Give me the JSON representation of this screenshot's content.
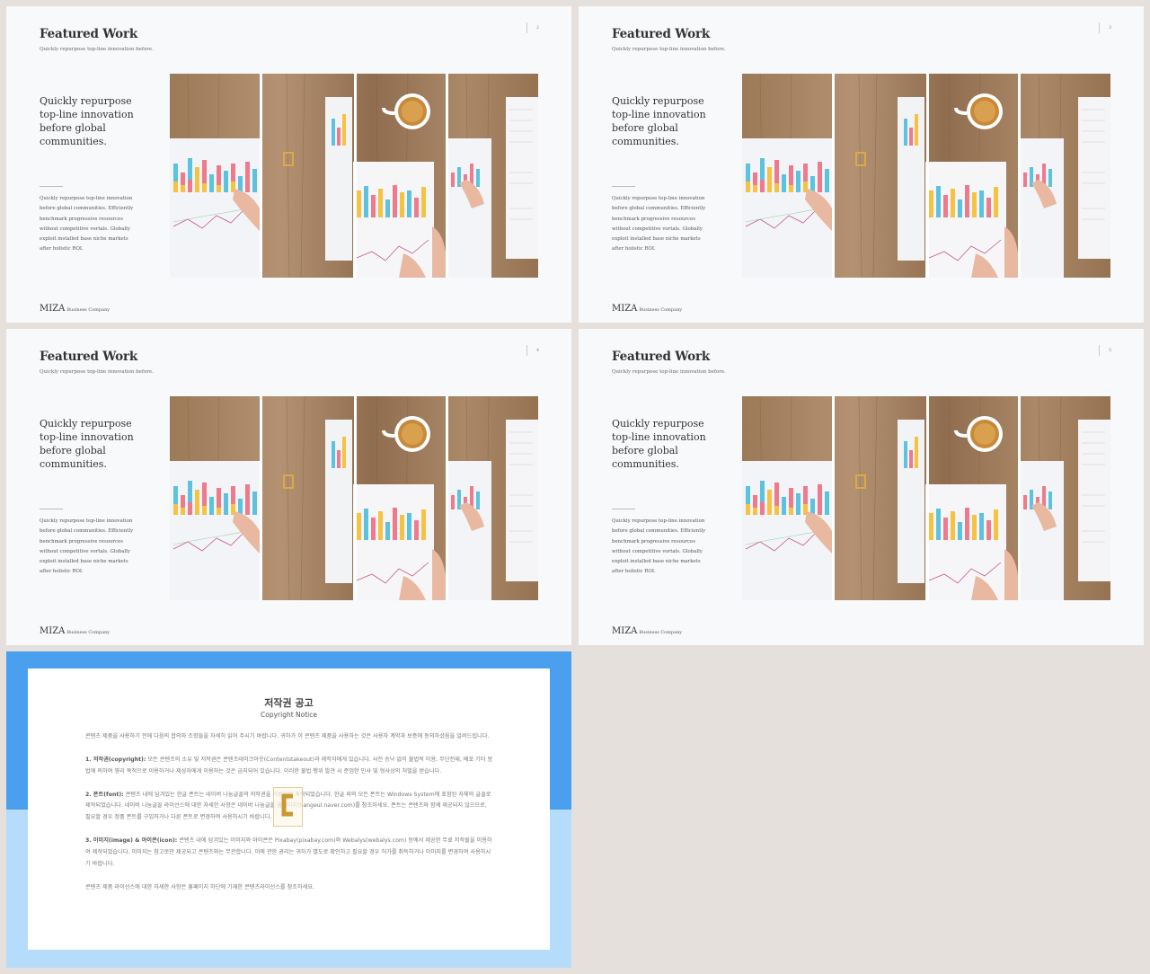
{
  "slides": [
    {
      "title": "Featured Work",
      "subtitle": "Quickly repurpose top-line innovation before.",
      "page_number": "2",
      "headline": "Quickly repurpose top-line innovation before global communities.",
      "body": "Quickly repurpose top-line innovation before global communities. Efficiently benchmark progressive resources without competitive vortals. Globally exploit installed base niche markets after holistic ROI.",
      "brand": "MIZA",
      "brand_sub": "Business Company"
    },
    {
      "title": "Featured Work",
      "subtitle": "Quickly repurpose top-line innovation before.",
      "page_number": "3",
      "headline": "Quickly repurpose top-line innovation before global communities.",
      "body": "Quickly repurpose top-line innovation before global communities. Efficiently benchmark progressive resources without competitive vortals. Globally exploit installed base niche markets after holistic ROI.",
      "brand": "MIZA",
      "brand_sub": "Business Company"
    },
    {
      "title": "Featured Work",
      "subtitle": "Quickly repurpose top-line innovation before.",
      "page_number": "4",
      "headline": "Quickly repurpose top-line innovation before global communities.",
      "body": "Quickly repurpose top-line innovation before global communities. Efficiently benchmark progressive resources without competitive vortals. Globally exploit installed base niche markets after holistic ROI.",
      "brand": "MIZA",
      "brand_sub": "Business Company"
    },
    {
      "title": "Featured Work",
      "subtitle": "Quickly repurpose top-line innovation before.",
      "page_number": "5",
      "headline": "Quickly repurpose top-line innovation before global communities.",
      "body": "Quickly repurpose top-line innovation before global communities. Efficiently benchmark progressive resources without competitive vortals. Globally exploit installed base niche markets after holistic ROI.",
      "brand": "MIZA",
      "brand_sub": "Business Company"
    }
  ],
  "copyright": {
    "title": "저작권 공고",
    "subtitle": "Copyright Notice",
    "intro": "콘텐츠 제품을 사용하기 전에 다음의 합의와 조항들을 자세히 읽어 주시기 바랍니다. 귀하가 이 콘텐츠 제품을 사용하는 것은 사용자 계약과 보증에 동의하셨음을 알려드립니다.",
    "section1_head": "1. 저작권(copyright):",
    "section1": "모든 콘텐츠의 소유 및 저작권은 콘텐츠테이크아웃(Contentstakeout)과 제작자에게 있습니다. 사전 승낙 없이 불법적 이용, 무단전재, 배포 기타 방법에 의하여 영리 목적으로 이용하거나 제삼자에게 이용하는 것은 금지되어 있습니다. 이러한 불법 행위 발견 시 준엄한 민사 및 형사상의 처벌을 받습니다.",
    "section2_head": "2. 폰트(font):",
    "section2": "콘텐츠 내에 담겨있는 한글 폰트는 네이버 나눔글꼴의 저작권을 기준하여 제작되었습니다. 한글 외의 모든 폰트는 Windows System에 포함된 자체의 글꼴로 제작되었습니다. 네이버 나눔글꼴 라이선스에 대한 자세한 사항은 네이버 나눔글꼴 홈페이지(hangeul.naver.com)를 참조하세요. 폰트는 콘텐츠와 함께 제공되지 않으므로, 필요할 경우 정품 폰트를 구입하거나 다른 폰트로 변경하여 사용하시기 바랍니다.",
    "section3_head": "3. 이미지(image) & 아이콘(icon):",
    "section3": "콘텐츠 내에 담겨있는 이미지와 아이콘은 Pixabay(pixabay.com)와 Webalys(webalys.com) 등에서 제공한 무료 저작물을 이용하여 제작되었습니다. 이미지는 참고로만 제공되고 콘텐츠와는 무관합니다. 이에 관한 권리는 귀하가 별도로 확인하고 필요할 경우 허가를 취득하거나 이미지를 변경하여 사용하시기 바랍니다.",
    "outro": "콘텐츠 제품 라이선스에 대한 자세한 사항은 홈페이지 하단에 기재한 콘텐츠라이선스를 참조하세요."
  },
  "colors": {
    "panel_blue": "#4aa0ef",
    "panel_light_blue": "#b5dcfa",
    "background": "#e5e0dc",
    "slide_bg": "#f8f9fb"
  }
}
